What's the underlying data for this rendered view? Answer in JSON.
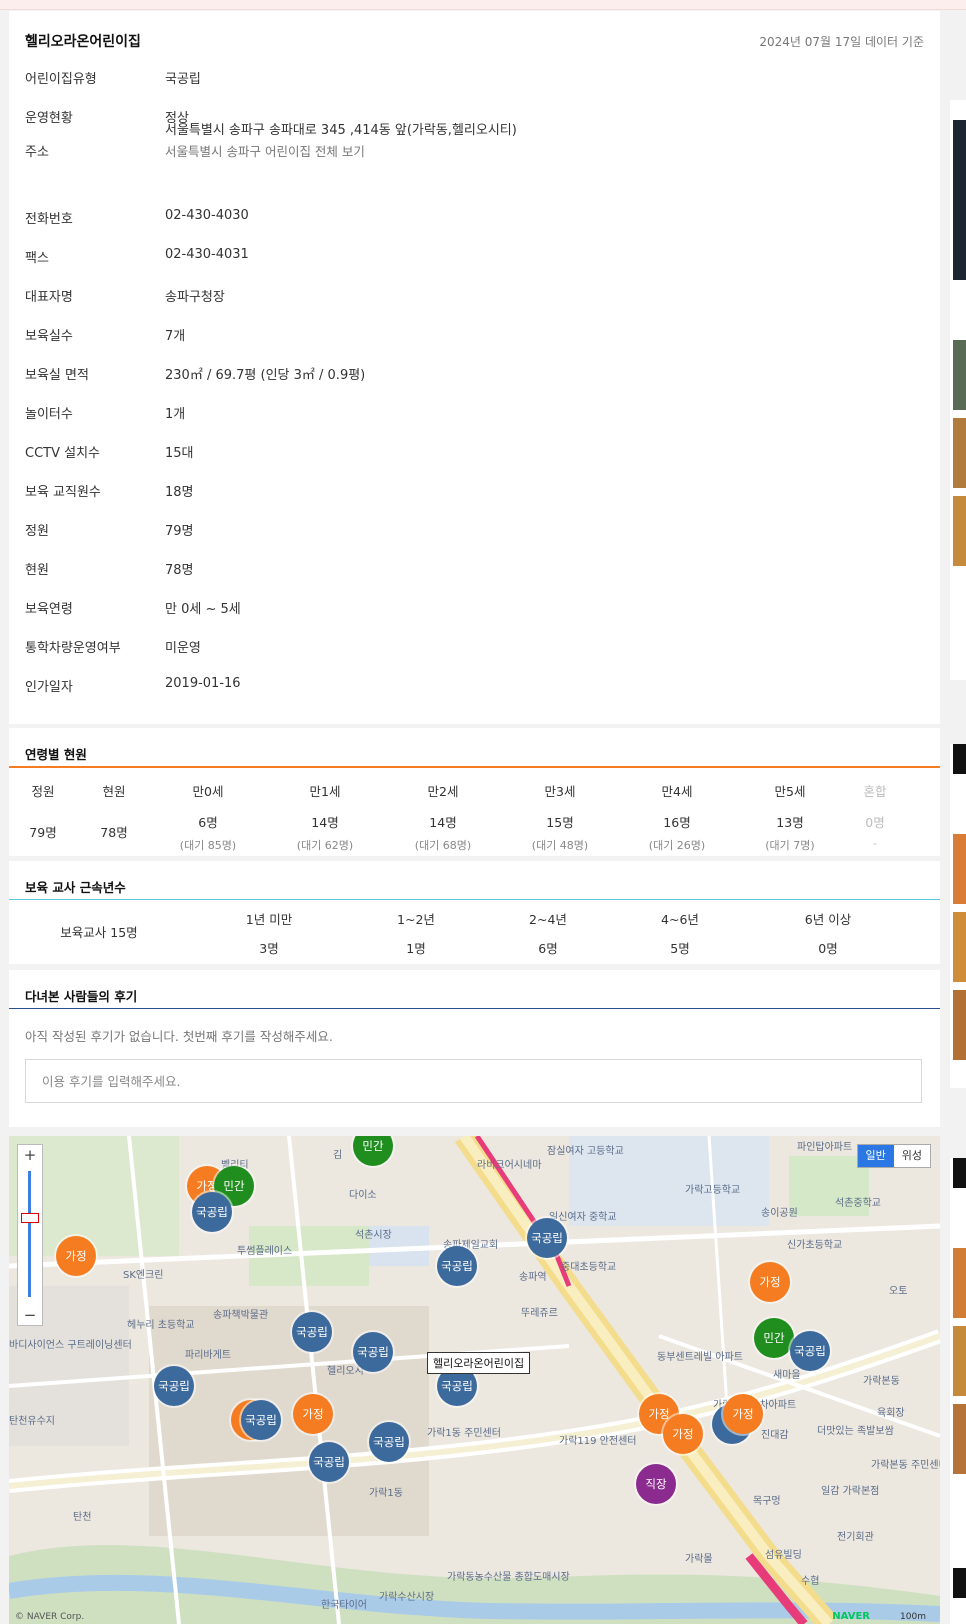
{
  "info": {
    "title": "헬리오라온어린이집",
    "date": "2024년 07월 17일 데이터 기준",
    "rows": [
      {
        "label": "어린이집유형",
        "value": "국공립"
      },
      {
        "label": "운영현황",
        "value": "정상"
      },
      {
        "label": "주소",
        "value": "서울특별시 송파구 송파대로 345 ,414동 앞(가락동,헬리오시티)",
        "link": "서울특별시 송파구 어린이집 전체 보기"
      },
      {
        "label": "전화번호",
        "value": "02-430-4030"
      },
      {
        "label": "팩스",
        "value": "02-430-4031"
      },
      {
        "label": "대표자명",
        "value": "송파구청장"
      },
      {
        "label": "보육실수",
        "value": "7개"
      },
      {
        "label": "보육실 면적",
        "value": "230㎡ / 69.7평 (인당 3㎡ / 0.9평)"
      },
      {
        "label": "놀이터수",
        "value": "1개"
      },
      {
        "label": "CCTV 설치수",
        "value": "15대"
      },
      {
        "label": "보육 교직원수",
        "value": "18명"
      },
      {
        "label": "정원",
        "value": "79명"
      },
      {
        "label": "현원",
        "value": "78명"
      },
      {
        "label": "보육연령",
        "value": "만 0세 ~ 5세"
      },
      {
        "label": "통학차량운영여부",
        "value": "미운영"
      },
      {
        "label": "인가일자",
        "value": "2019-01-16"
      }
    ]
  },
  "age": {
    "title": "연령별 현원",
    "headers": [
      "정원",
      "현원",
      "만0세",
      "만1세",
      "만2세",
      "만3세",
      "만4세",
      "만5세",
      "혼합"
    ],
    "values": [
      "79명",
      "78명",
      "6명",
      "14명",
      "14명",
      "15명",
      "16명",
      "13명",
      "0명"
    ],
    "waits": [
      "",
      "",
      "(대기 85명)",
      "(대기 62명)",
      "(대기 68명)",
      "(대기 48명)",
      "(대기 26명)",
      "(대기 7명)",
      "-"
    ]
  },
  "tenure": {
    "title": "보육 교사 근속년수",
    "total_label": "보육교사 15명",
    "headers": [
      "1년 미만",
      "1~2년",
      "2~4년",
      "4~6년",
      "6년 이상"
    ],
    "values": [
      "3명",
      "1명",
      "6명",
      "5명",
      "0명"
    ]
  },
  "reviews": {
    "title": "다녀본 사람들의 후기",
    "empty_text": "아직 작성된 후기가 없습니다. 첫번째 후기를 작성해주세요.",
    "input_placeholder": "이용 후기를 입력해주세요."
  },
  "map": {
    "zoom_in": "+",
    "zoom_out": "−",
    "type_normal": "일반",
    "type_satellite": "위성",
    "tooltip": "헬리오라온어린이집",
    "attribution": "© NAVER Corp.",
    "brand": "NAVER",
    "scale": "100m",
    "colors": {
      "public": "#3d6a9c",
      "home": "#f57c20",
      "private": "#1f8e1f",
      "work": "#8b2a8f"
    },
    "pins": [
      {
        "type": "private",
        "label": "민간"
      },
      {
        "type": "home",
        "label": "가정"
      },
      {
        "type": "private",
        "label": "민간"
      },
      {
        "type": "public",
        "label": "국공립"
      },
      {
        "type": "home",
        "label": "가정"
      },
      {
        "type": "public",
        "label": "국공립"
      },
      {
        "type": "public",
        "label": "국공립"
      },
      {
        "type": "public",
        "label": "국공립"
      },
      {
        "type": "public",
        "label": "국공립"
      },
      {
        "type": "public",
        "label": "국공립"
      },
      {
        "type": "public",
        "label": "국공립"
      },
      {
        "type": "home",
        "label": "가"
      },
      {
        "type": "public",
        "label": "국공립"
      },
      {
        "type": "home",
        "label": "가정"
      },
      {
        "type": "public",
        "label": "국공립"
      },
      {
        "type": "public",
        "label": "국공립"
      },
      {
        "type": "home",
        "label": "가정"
      },
      {
        "type": "private",
        "label": "민간"
      },
      {
        "type": "public",
        "label": "국공립"
      },
      {
        "type": "home",
        "label": "가정"
      },
      {
        "type": "home",
        "label": "가정"
      },
      {
        "type": "public",
        "label": "국"
      },
      {
        "type": "home",
        "label": "가정"
      },
      {
        "type": "work",
        "label": "직장"
      }
    ],
    "places": [
      "벨리티",
      "다이소",
      "석촌시장",
      "투썸플레이스",
      "SK엔크린",
      "송파책박물관",
      "헤누리 초등학교",
      "파리바게트",
      "헬리오시",
      "가락1동 주민센터",
      "가락1동",
      "탄천",
      "탄천유수지",
      "바디사이언스 구트레이닝센터",
      "잠실여자 고등학교",
      "가락고등학교",
      "송이공원",
      "석촌중학교",
      "신가초등학교",
      "송파제일교회",
      "일신여자 중학교",
      "중대초등학교",
      "송파역",
      "뚜레쥬르",
      "가락119 안전센터",
      "동부센트레빌 아파트",
      "가락우성 1차아파트",
      "진대감",
      "더맛있는 족발보쌈",
      "가락본동",
      "가락본동 주민센터",
      "육회장",
      "일감 가락본점",
      "목구멍",
      "전기회관",
      "가락동농수산물 종합도매시장",
      "가락수산시장",
      "한국타이어",
      "파인탑아파트",
      "라비크어시네마",
      "오토",
      "섬유빌딩",
      "수협",
      "가락몰",
      "새마을",
      "NH",
      "김"
    ]
  }
}
